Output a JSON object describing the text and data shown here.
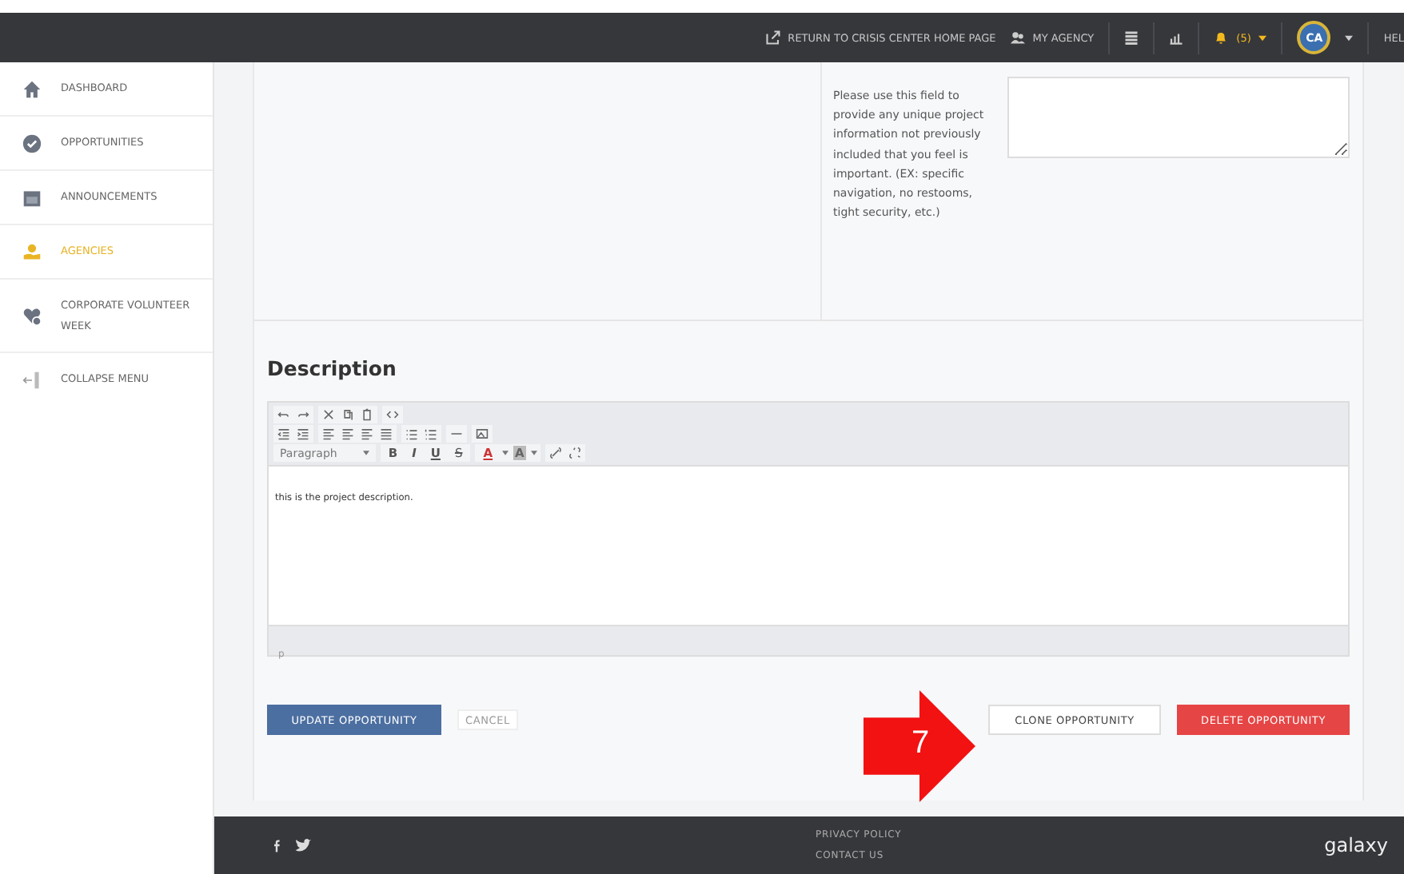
{
  "topbar": {
    "links": [
      {
        "kind": "return",
        "label": "RETURN TO CRISIS CENTER HOME PAGE"
      },
      {
        "kind": "agency",
        "label": "MY AGENCY"
      }
    ],
    "notifications": {
      "count": "(5)"
    },
    "avatar": {
      "initials": "CA"
    },
    "help": "HEL"
  },
  "sidebar": {
    "items": [
      {
        "kind": "home",
        "label": "DASHBOARD",
        "selected": false
      },
      {
        "kind": "check",
        "label": "OPPORTUNITIES",
        "selected": false
      },
      {
        "kind": "calendar",
        "label": "ANNOUNCEMENTS",
        "selected": false
      },
      {
        "kind": "hand",
        "label": "AGENCIES",
        "selected": true
      },
      {
        "kind": "heart",
        "label": "CORPORATE VOLUNTEER WEEK",
        "selected": false
      }
    ],
    "collapse": "COLLAPSE MENU"
  },
  "unique_info": {
    "help": "Please use this field to provide any unique project information not previously included that you feel is important. (EX: specific navigation, no restooms, tight security, etc.)"
  },
  "description": {
    "heading": "Description",
    "format": "Paragraph",
    "text_buttons": [
      "B",
      "I",
      "U",
      "S"
    ],
    "color_letter": "A",
    "highlight_letter": "A",
    "body": "this is the project description.",
    "path": "p"
  },
  "actions": {
    "update": "UPDATE OPPORTUNITY",
    "cancel": "CANCEL",
    "clone": "CLONE OPPORTUNITY",
    "delete": "DELETE OPPORTUNITY"
  },
  "annotation": {
    "number": "7"
  },
  "footer": {
    "links": [
      "PRIVACY POLICY",
      "CONTACT US"
    ],
    "logo": "galaxy"
  }
}
